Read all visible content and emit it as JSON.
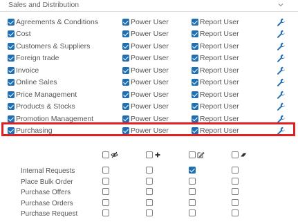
{
  "section": {
    "title": "Sales and Distribution"
  },
  "permission_rows": [
    {
      "label": "Agreements & Conditions",
      "checked": true,
      "power_user_label": "Power User",
      "power_user_checked": true,
      "report_user_label": "Report User",
      "report_user_checked": true
    },
    {
      "label": "Cost",
      "checked": true,
      "power_user_label": "Power User",
      "power_user_checked": true,
      "report_user_label": "Report User",
      "report_user_checked": true
    },
    {
      "label": "Customers & Suppliers",
      "checked": true,
      "power_user_label": "Power User",
      "power_user_checked": true,
      "report_user_label": "Report User",
      "report_user_checked": true
    },
    {
      "label": "Foreign trade",
      "checked": true,
      "power_user_label": "Power User",
      "power_user_checked": true,
      "report_user_label": "Report User",
      "report_user_checked": true
    },
    {
      "label": "Invoice",
      "checked": true,
      "power_user_label": "Power User",
      "power_user_checked": true,
      "report_user_label": "Report User",
      "report_user_checked": true
    },
    {
      "label": "Online Sales",
      "checked": true,
      "power_user_label": "Power User",
      "power_user_checked": true,
      "report_user_label": "Report User",
      "report_user_checked": true
    },
    {
      "label": "Price Management",
      "checked": true,
      "power_user_label": "Power User",
      "power_user_checked": true,
      "report_user_label": "Report User",
      "report_user_checked": true
    },
    {
      "label": "Products & Stocks",
      "checked": true,
      "power_user_label": "Power User",
      "power_user_checked": true,
      "report_user_label": "Report User",
      "report_user_checked": true
    },
    {
      "label": "Promotion Management",
      "checked": true,
      "power_user_label": "Power User",
      "power_user_checked": true,
      "report_user_label": "Report User",
      "report_user_checked": true
    },
    {
      "label": "Purchasing",
      "checked": true,
      "power_user_label": "Power User",
      "power_user_checked": true,
      "report_user_label": "Report User",
      "report_user_checked": true,
      "highlighted": true
    }
  ],
  "detail_grid": {
    "columns": [
      {
        "icon": "eye-off-icon",
        "checked": false
      },
      {
        "icon": "plus-icon",
        "checked": false
      },
      {
        "icon": "edit-icon",
        "checked": false
      },
      {
        "icon": "eraser-icon",
        "checked": false
      }
    ],
    "rows": [
      {
        "label": "Internal Requests",
        "values": [
          false,
          false,
          true,
          false
        ]
      },
      {
        "label": "Place Bulk Order",
        "values": [
          false,
          false,
          false,
          false
        ]
      },
      {
        "label": "Purchase Offers",
        "values": [
          false,
          false,
          false,
          false
        ]
      },
      {
        "label": "Purchase Orders",
        "values": [
          false,
          false,
          false,
          false
        ]
      },
      {
        "label": "Purchase Request",
        "values": [
          false,
          false,
          false,
          false
        ]
      }
    ]
  },
  "colors": {
    "accent": "#1f6fb4",
    "highlight": "#e02020",
    "text": "#555555"
  }
}
